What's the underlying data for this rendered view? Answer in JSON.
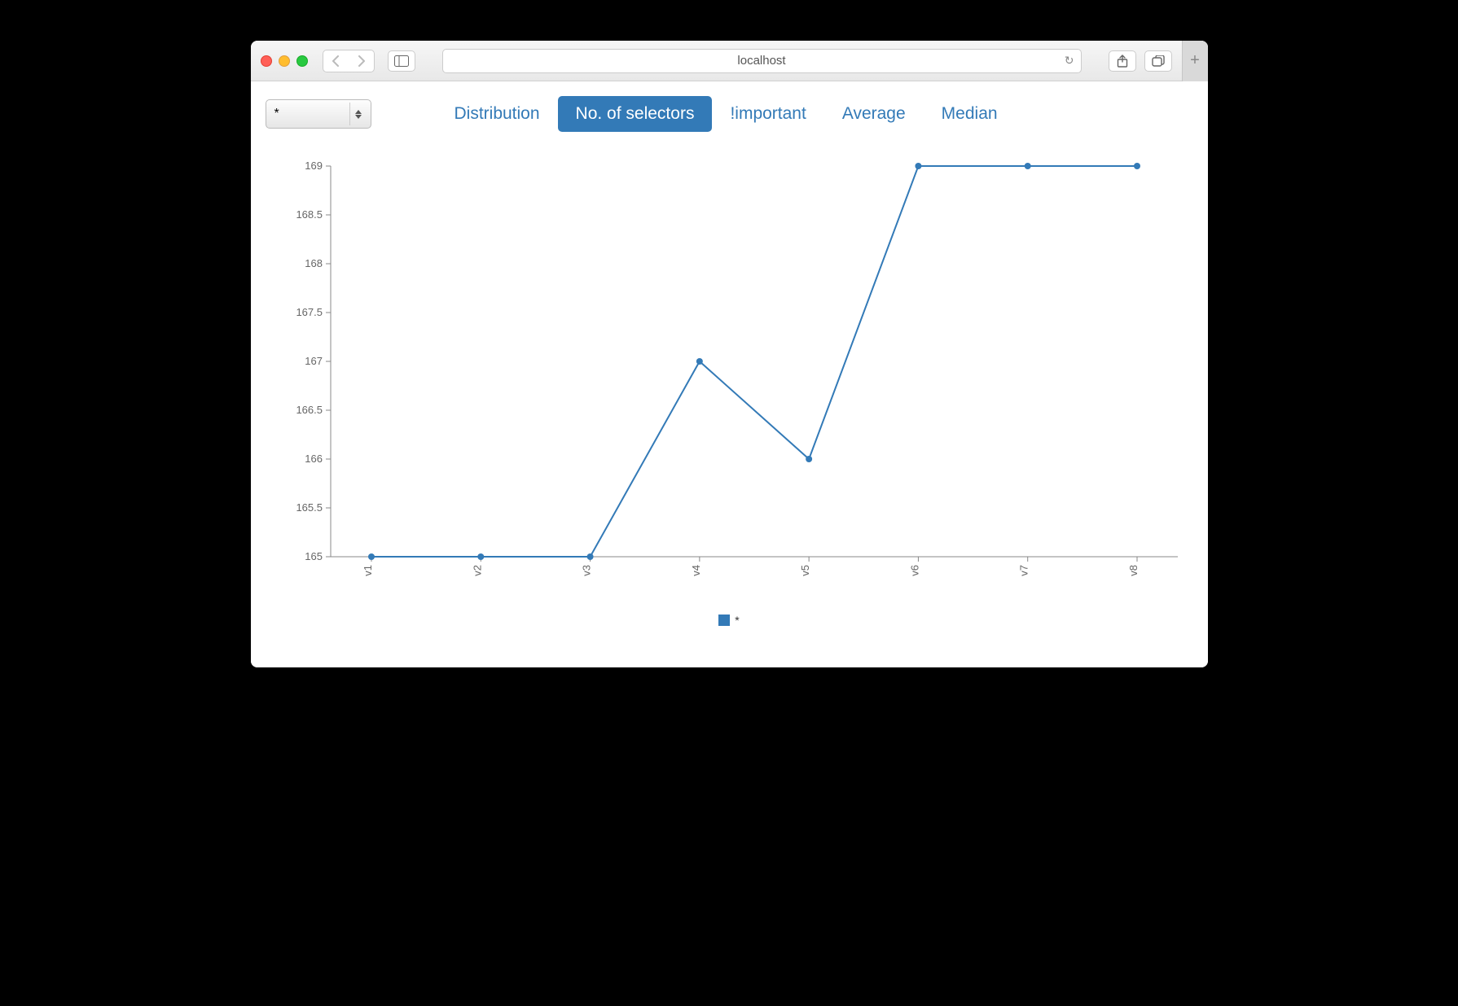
{
  "browser": {
    "host": "localhost"
  },
  "selector": {
    "value": "*"
  },
  "tabs": [
    {
      "id": "distribution",
      "label": "Distribution",
      "active": false
    },
    {
      "id": "noselectors",
      "label": "No. of selectors",
      "active": true
    },
    {
      "id": "important",
      "label": "!important",
      "active": false
    },
    {
      "id": "average",
      "label": "Average",
      "active": false
    },
    {
      "id": "median",
      "label": "Median",
      "active": false
    }
  ],
  "legend": {
    "label": "*"
  },
  "y_ticks": [
    "169",
    "168.5",
    "168",
    "167.5",
    "167",
    "166.5",
    "166",
    "165.5",
    "165"
  ],
  "x_labels": [
    "v1",
    "v2",
    "v3",
    "v4",
    "v5",
    "v6",
    "v7",
    "v8"
  ],
  "chart_data": {
    "type": "line",
    "categories": [
      "v1",
      "v2",
      "v3",
      "v4",
      "v5",
      "v6",
      "v7",
      "v8"
    ],
    "series": [
      {
        "name": "*",
        "values": [
          165,
          165,
          165,
          167,
          166,
          169,
          169,
          169
        ]
      }
    ],
    "ylim": [
      165,
      169
    ],
    "y_ticks": [
      165,
      165.5,
      166,
      166.5,
      167,
      167.5,
      168,
      168.5,
      169
    ],
    "xlabel": "",
    "ylabel": "",
    "title": ""
  }
}
